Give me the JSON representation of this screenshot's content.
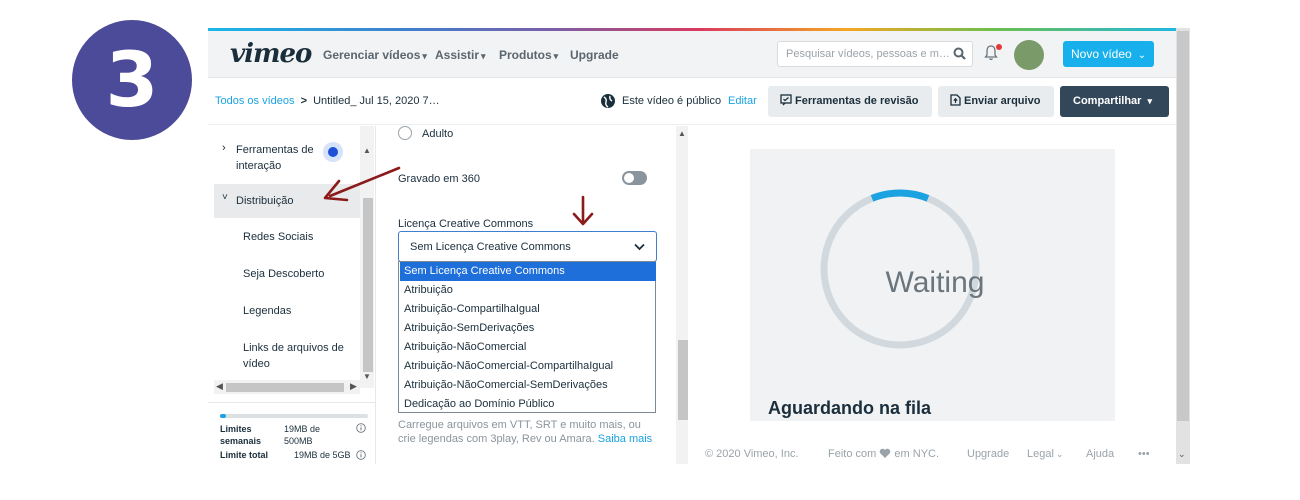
{
  "step_number": "3",
  "topbar": {
    "logo": "vimeo",
    "nav": [
      "Gerenciar vídeos",
      "Assistir",
      "Produtos",
      "Upgrade"
    ],
    "search_placeholder": "Pesquisar vídeos, pessoas e m…",
    "new_video": "Novo vídeo"
  },
  "subbar": {
    "breadcrumb_root": "Todos os vídeos",
    "breadcrumb_sep": ">",
    "breadcrumb_current": "Untitled_ Jul 15, 2020 7…",
    "public_text": "Este vídeo é público",
    "edit_link": "Editar",
    "review_tools": "Ferramentas de revisão",
    "upload_file": "Enviar arquivo",
    "share": "Compartilhar"
  },
  "sidebar": {
    "interaction_tools_line1": "Ferramentas de",
    "interaction_tools_line2": "interação",
    "distribution": "Distribuição",
    "items": [
      "Redes Sociais",
      "Seja Descoberto",
      "Legendas"
    ],
    "file_links_line1": "Links de arquivos de",
    "file_links_line2": "vídeo",
    "limits": {
      "weekly_label_1": "Limites",
      "weekly_label_2": "semanais",
      "weekly_value_1": "19MB de",
      "weekly_value_2": "500MB",
      "total_label": "Limite total",
      "total_value": "19MB de 5GB",
      "weekly_used_fraction": 0.04
    }
  },
  "middle": {
    "adult_label": "Adulto",
    "recorded_360": "Gravado em 360",
    "license_label": "Licença Creative Commons",
    "license_selected": "Sem Licença Creative Commons",
    "license_options": [
      "Sem Licença Creative Commons",
      "Atribuição",
      "Atribuição-CompartilhaIgual",
      "Atribuição-SemDerivações",
      "Atribuição-NãoComercial",
      "Atribuição-NãoComercial-CompartilhaIgual",
      "Atribuição-NãoComercial-SemDerivações",
      "Dedicação ao Domínio Público"
    ],
    "captions_help_1": "Carregue arquivos em VTT, SRT e muito mais, ou",
    "captions_help_2": "crie legendas com 3play, Rev ou Amara.",
    "learn_more": "Saiba mais"
  },
  "player": {
    "waiting": "Waiting",
    "queue_status": "Aguardando na fila",
    "progress_fraction": 0.12
  },
  "footer": {
    "copyright": "© 2020 Vimeo, Inc.",
    "made_with_1": "Feito com",
    "made_with_2": "em NYC.",
    "upgrade": "Upgrade",
    "legal": "Legal",
    "help": "Ajuda",
    "more": "•••"
  },
  "colors": {
    "step_badge": "#4b4b9a",
    "vimeo_blue": "#17b0ec",
    "share_button": "#33475b",
    "selected_option": "#1e6fd9",
    "annotation_arrow": "#8b1a1a"
  }
}
